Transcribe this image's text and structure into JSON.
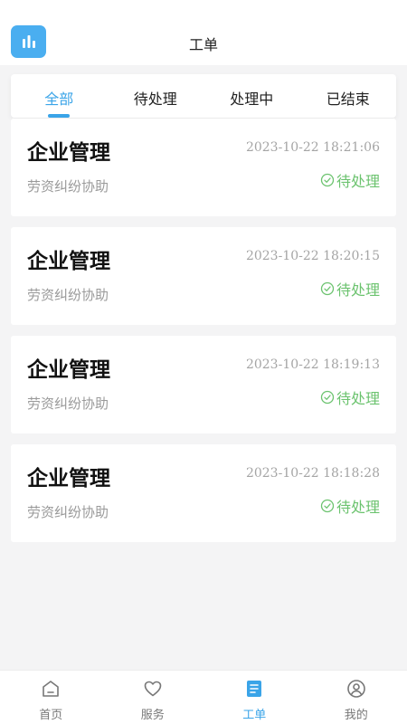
{
  "header": {
    "title": "工单",
    "logo_icon": "bar-chart-icon"
  },
  "tabs": [
    {
      "label": "全部",
      "active": true
    },
    {
      "label": "待处理",
      "active": false
    },
    {
      "label": "处理中",
      "active": false
    },
    {
      "label": "已结束",
      "active": false
    }
  ],
  "tickets": [
    {
      "title": "企业管理",
      "subtitle": "劳资纠纷协助",
      "time": "2023-10-22 18:21:06",
      "status": "待处理"
    },
    {
      "title": "企业管理",
      "subtitle": "劳资纠纷协助",
      "time": "2023-10-22 18:20:15",
      "status": "待处理"
    },
    {
      "title": "企业管理",
      "subtitle": "劳资纠纷协助",
      "time": "2023-10-22 18:19:13",
      "status": "待处理"
    },
    {
      "title": "企业管理",
      "subtitle": "劳资纠纷协助",
      "time": "2023-10-22 18:18:28",
      "status": "待处理"
    }
  ],
  "bottom_nav": [
    {
      "label": "首页",
      "icon": "home-icon",
      "active": false
    },
    {
      "label": "服务",
      "icon": "heart-icon",
      "active": false
    },
    {
      "label": "工单",
      "icon": "document-icon",
      "active": true
    },
    {
      "label": "我的",
      "icon": "user-icon",
      "active": false
    }
  ],
  "colors": {
    "accent": "#3aa4e8",
    "status_pending": "#6cc36f",
    "background": "#f4f4f5"
  }
}
